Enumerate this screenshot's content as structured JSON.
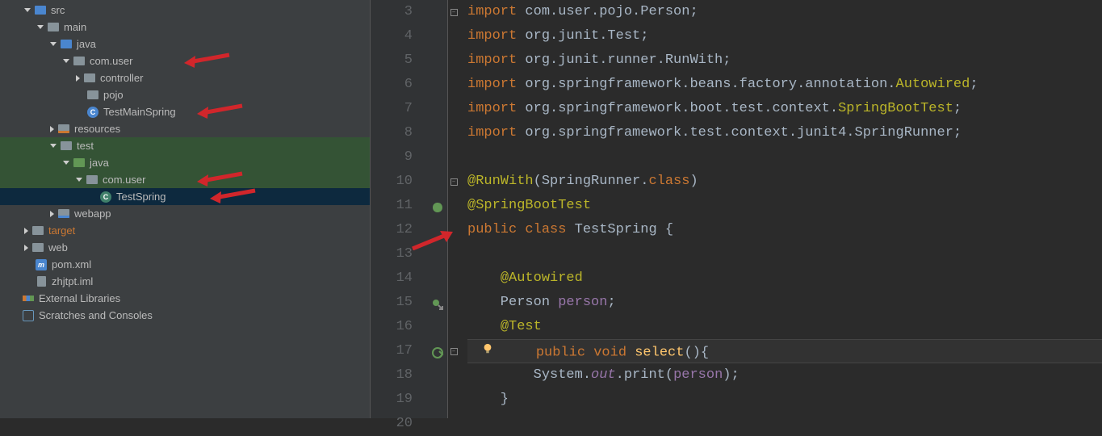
{
  "tree": [
    {
      "d": 0,
      "a": "open",
      "i": "folder-blue",
      "t": "src"
    },
    {
      "d": 1,
      "a": "open",
      "i": "folder",
      "t": "main"
    },
    {
      "d": 2,
      "a": "open",
      "i": "folder-blue",
      "t": "java"
    },
    {
      "d": 3,
      "a": "open",
      "i": "folder",
      "t": "com.user",
      "arrow": true
    },
    {
      "d": 4,
      "a": "closed",
      "i": "folder",
      "t": "controller"
    },
    {
      "d": 4,
      "a": "none",
      "i": "folder",
      "t": "pojo"
    },
    {
      "d": 4,
      "a": "none",
      "i": "class",
      "t": "TestMainSpring",
      "arrow": true
    },
    {
      "d": 2,
      "a": "closed",
      "i": "folder-res",
      "t": "resources"
    },
    {
      "d": 2,
      "a": "open",
      "i": "folder",
      "t": "test",
      "test": true
    },
    {
      "d": 3,
      "a": "open",
      "i": "folder-test",
      "t": "java",
      "test": true
    },
    {
      "d": 4,
      "a": "open",
      "i": "folder",
      "t": "com.user",
      "test": true,
      "arrow": true
    },
    {
      "d": 5,
      "a": "none",
      "i": "class-sel",
      "t": "TestSpring",
      "sel": true,
      "arrow": true
    },
    {
      "d": 2,
      "a": "closed",
      "i": "folder-web",
      "t": "webapp"
    },
    {
      "d": 0,
      "a": "closed",
      "i": "folder",
      "t": "target",
      "orange": true
    },
    {
      "d": 0,
      "a": "closed",
      "i": "folder",
      "t": "web"
    },
    {
      "d": 0,
      "a": "none",
      "i": "m",
      "t": "pom.xml"
    },
    {
      "d": 0,
      "a": "none",
      "i": "file",
      "t": "zhjtpt.iml"
    },
    {
      "d": -1,
      "a": "none",
      "i": "lib",
      "t": "External Libraries"
    },
    {
      "d": -1,
      "a": "none",
      "i": "scratch",
      "t": "Scratches and Consoles"
    }
  ],
  "gutter_start": 3,
  "line_count": 18,
  "gutter_markers": {
    "11": "leaf",
    "12": "error",
    "15": "override",
    "17": "nav"
  },
  "bulb_line": 17,
  "fold_minus": [
    3,
    10,
    17
  ],
  "caret_line": 17,
  "red_arrow_rows": [
    3,
    6,
    10,
    11
  ],
  "editor_red_arrow": true,
  "code": {
    "3": [
      [
        "kw",
        "import"
      ],
      [
        "plain",
        " com.user.pojo.Person;"
      ]
    ],
    "4": [
      [
        "kw",
        "import"
      ],
      [
        "plain",
        " org.junit.Test;"
      ]
    ],
    "5": [
      [
        "kw",
        "import"
      ],
      [
        "plain",
        " org.junit.runner.RunWith;"
      ]
    ],
    "6": [
      [
        "kw",
        "import"
      ],
      [
        "plain",
        " org.springframework.beans.factory.annotation."
      ],
      [
        "ann",
        "Autowired"
      ],
      [
        "plain",
        ";"
      ]
    ],
    "7": [
      [
        "kw",
        "import"
      ],
      [
        "plain",
        " org.springframework.boot.test.context."
      ],
      [
        "ann",
        "SpringBootTest"
      ],
      [
        "plain",
        ";"
      ]
    ],
    "8": [
      [
        "kw",
        "import"
      ],
      [
        "plain",
        " org.springframework.test.context.junit4.SpringRunner;"
      ]
    ],
    "9": [],
    "10": [
      [
        "ann",
        "@RunWith"
      ],
      [
        "plain",
        "(SpringRunner."
      ],
      [
        "kw",
        "class"
      ],
      [
        "plain",
        ")"
      ]
    ],
    "11": [
      [
        "ann",
        "@SpringBootTest"
      ]
    ],
    "12": [
      [
        "kw",
        "public class"
      ],
      [
        "plain",
        " TestSpring {"
      ]
    ],
    "13": [],
    "14": [
      [
        "plain",
        "    "
      ],
      [
        "ann",
        "@Autowired"
      ]
    ],
    "15": [
      [
        "plain",
        "    Person "
      ],
      [
        "fld",
        "person"
      ],
      [
        "plain",
        ";"
      ]
    ],
    "16": [
      [
        "plain",
        "    "
      ],
      [
        "ann",
        "@Test"
      ]
    ],
    "17": [
      [
        "plain",
        "    "
      ],
      [
        "kw",
        "public void"
      ],
      [
        "plain",
        " "
      ],
      [
        "fn",
        "select"
      ],
      [
        "plain",
        "(){"
      ]
    ],
    "18": [
      [
        "plain",
        "        System."
      ],
      [
        "fld ital",
        "out"
      ],
      [
        "plain",
        ".print("
      ],
      [
        "fld",
        "person"
      ],
      [
        "plain",
        ");"
      ]
    ],
    "19": [
      [
        "plain",
        "    }"
      ]
    ],
    "20": []
  }
}
